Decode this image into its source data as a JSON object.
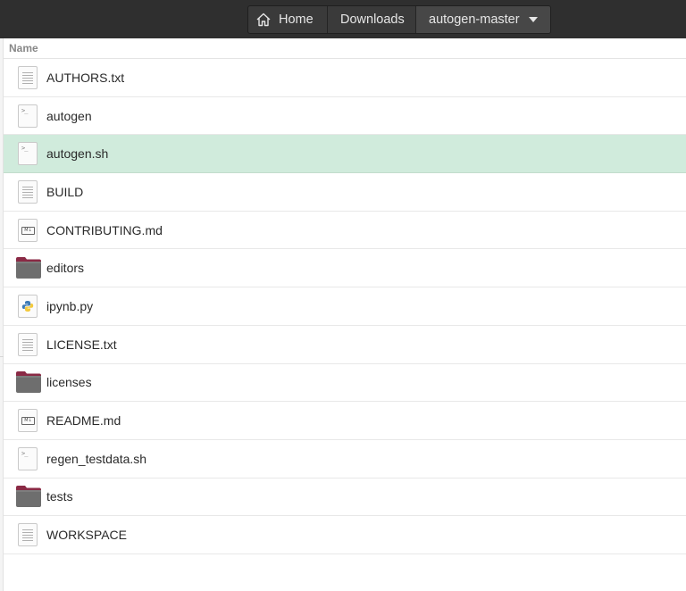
{
  "breadcrumb": {
    "items": [
      {
        "label": "Home",
        "icon": "home-icon"
      },
      {
        "label": "Downloads"
      },
      {
        "label": "autogen-master",
        "icon": "chevron-down-icon"
      }
    ]
  },
  "list": {
    "column_name": "Name",
    "files": [
      {
        "name": "AUTHORS.txt",
        "icon": "text-file-icon"
      },
      {
        "name": "autogen",
        "icon": "script-file-icon"
      },
      {
        "name": "autogen.sh",
        "icon": "script-file-icon",
        "selected": true
      },
      {
        "name": "BUILD",
        "icon": "text-file-icon"
      },
      {
        "name": "CONTRIBUTING.md",
        "icon": "markdown-file-icon"
      },
      {
        "name": "editors",
        "icon": "folder-icon"
      },
      {
        "name": "ipynb.py",
        "icon": "python-file-icon"
      },
      {
        "name": "LICENSE.txt",
        "icon": "text-file-icon"
      },
      {
        "name": "licenses",
        "icon": "folder-icon"
      },
      {
        "name": "README.md",
        "icon": "markdown-file-icon"
      },
      {
        "name": "regen_testdata.sh",
        "icon": "script-file-icon"
      },
      {
        "name": "tests",
        "icon": "folder-icon"
      },
      {
        "name": "WORKSPACE",
        "icon": "text-file-icon"
      }
    ]
  },
  "colors": {
    "headerbar": "#2f2f2f",
    "selection": "#d0ebdc",
    "folder_tab": "#8a2a45",
    "folder_body": "#6e6e6e"
  }
}
